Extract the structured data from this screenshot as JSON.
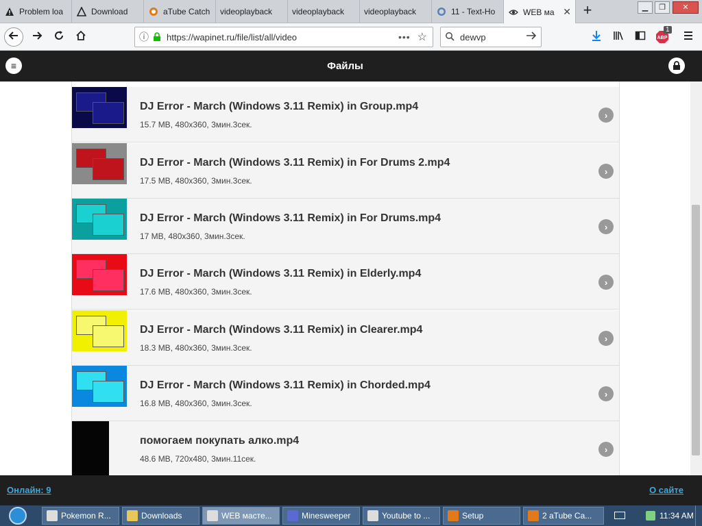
{
  "browser": {
    "tabs": [
      {
        "label": "Problem loa",
        "icon": "warning-icon"
      },
      {
        "label": "Download",
        "icon": "warning-icon"
      },
      {
        "label": "aTube Catch",
        "icon": "atube-icon"
      },
      {
        "label": "videoplayback",
        "icon": ""
      },
      {
        "label": "videoplayback",
        "icon": ""
      },
      {
        "label": "videoplayback",
        "icon": ""
      },
      {
        "label": "11 - Text-Ho",
        "icon": "page-icon"
      },
      {
        "label": "WEB ма",
        "icon": "eye-icon"
      }
    ],
    "url": "https://wapinet.ru/file/list/all/video",
    "search_value": "dewvp",
    "badge_count": "1"
  },
  "app": {
    "title": "Файлы"
  },
  "files": [
    {
      "name": "DJ Error - March (Windows 3.11 Remix) in Group.mp4",
      "meta": "15.7 MB, 480x360, 3мин.3сек.",
      "thumb_color": "#0a0a4a",
      "win_color": "#1a1a8a"
    },
    {
      "name": "DJ Error - March (Windows 3.11 Remix) in For Drums 2.mp4",
      "meta": "17.5 MB, 480x360, 3мин.3сек.",
      "thumb_color": "#8a8a8a",
      "win_color": "#c0141c"
    },
    {
      "name": "DJ Error - March (Windows 3.11 Remix) in For Drums.mp4",
      "meta": "17 MB, 480x360, 3мин.3сек.",
      "thumb_color": "#0aa0a0",
      "win_color": "#1ad0d0"
    },
    {
      "name": "DJ Error - March (Windows 3.11 Remix) in Elderly.mp4",
      "meta": "17.6 MB, 480x360, 3мин.3сек.",
      "thumb_color": "#e80a14",
      "win_color": "#ff3060"
    },
    {
      "name": "DJ Error - March (Windows 3.11 Remix) in Clearer.mp4",
      "meta": "18.3 MB, 480x360, 3мин.3сек.",
      "thumb_color": "#f0f000",
      "win_color": "#f8f870"
    },
    {
      "name": "DJ Error - March (Windows 3.11 Remix) in Chorded.mp4",
      "meta": "16.8 MB, 480x360, 3мин.3сек.",
      "thumb_color": "#0a88e0",
      "win_color": "#30e0f0"
    },
    {
      "name": "помогаем покупать алко.mp4",
      "meta": "48.6 MB, 720x480, 3мин.11сек.",
      "thumb_color": "#050505",
      "win_color": ""
    }
  ],
  "footer": {
    "online": "Онлайн: 9",
    "about": "О сайте"
  },
  "taskbar": {
    "items": [
      {
        "label": "Pokemon R..."
      },
      {
        "label": "Downloads"
      },
      {
        "label": "WEB масте..."
      },
      {
        "label": "Minesweeper"
      },
      {
        "label": "Youtube to ..."
      },
      {
        "label": "Setup"
      },
      {
        "label": "2 aTube Ca..."
      }
    ],
    "clock": "11:34 AM"
  }
}
